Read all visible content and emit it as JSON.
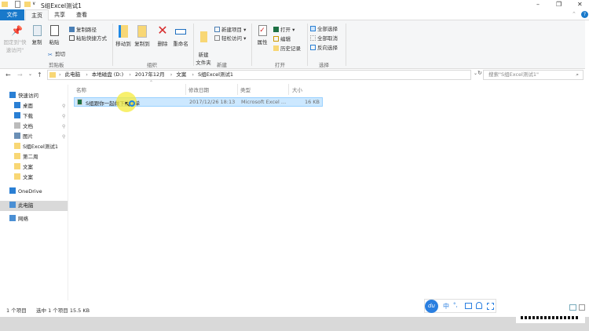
{
  "window": {
    "title": "S组Excel测试1",
    "minimize": "–",
    "maximize": "❐",
    "close": "✕",
    "qa_dropdown": "∨"
  },
  "tabs": [
    {
      "label": "文件"
    },
    {
      "label": "主页"
    },
    {
      "label": "共享"
    },
    {
      "label": "查看"
    }
  ],
  "ribbon": {
    "clipboard": {
      "label": "剪贴板",
      "pin": "固定到\"快速访问\"",
      "copy": "复制",
      "paste": "粘贴",
      "copy_path": "复制路径",
      "paste_shortcut": "粘贴快捷方式",
      "cut": "剪切"
    },
    "organize": {
      "label": "组织",
      "move_to": "移动到",
      "copy_to": "复制到",
      "delete": "删除",
      "rename": "重命名"
    },
    "new": {
      "label": "新建",
      "new_folder": "新建\n文件夹",
      "new_item": "新建项目 ▾",
      "easy_access": "轻松访问 ▾"
    },
    "open": {
      "label": "打开",
      "properties": "属性",
      "open": "打开 ▾",
      "edit": "编辑",
      "history": "历史记录"
    },
    "select": {
      "label": "选择",
      "select_all": "全部选择",
      "select_none": "全部取消",
      "invert": "反向选择"
    }
  },
  "nav": {
    "back": "←",
    "forward": "→",
    "recent": "⌄",
    "up": "↑",
    "refresh": "↻",
    "dropdown": "⌄"
  },
  "breadcrumb": [
    "此电脑",
    "本地磁盘 (D:)",
    "2017年12月",
    "文案",
    "S组Excel测试1"
  ],
  "search": {
    "placeholder": "搜索\"S组Excel测试1\""
  },
  "sidebar": [
    {
      "label": "快速访问",
      "icon": "star-icon"
    },
    {
      "label": "桌面",
      "icon": "desktop-icon",
      "pinned": true
    },
    {
      "label": "下载",
      "icon": "download-icon",
      "pinned": true
    },
    {
      "label": "文档",
      "icon": "document-icon",
      "pinned": true
    },
    {
      "label": "图片",
      "icon": "picture-icon",
      "pinned": true
    },
    {
      "label": "S组Excel测试1",
      "icon": "folder-icon"
    },
    {
      "label": "第二周",
      "icon": "folder-icon"
    },
    {
      "label": "文案",
      "icon": "folder-icon"
    },
    {
      "label": "文案",
      "icon": "folder-icon"
    },
    {
      "label": "OneDrive",
      "icon": "cloud-icon"
    },
    {
      "label": "此电脑",
      "icon": "computer-icon",
      "selected": true
    },
    {
      "label": "网络",
      "icon": "network-icon"
    }
  ],
  "columns": [
    "名称",
    "修改日期",
    "类型",
    "大小"
  ],
  "files": [
    {
      "name": "S组跟你一起做下拉菜单",
      "modified": "2017/12/26 18:13",
      "type": "Microsoft Excel ...",
      "size": "16 KB"
    }
  ],
  "status": {
    "count": "1 个项目",
    "selected": "选中 1 个项目  15.5 KB"
  },
  "ime": {
    "logo": "du",
    "lang": "中",
    "punct": "°,"
  },
  "colors": {
    "accent": "#1979ca",
    "selection": "#cce8ff",
    "folder": "#f8d775"
  }
}
